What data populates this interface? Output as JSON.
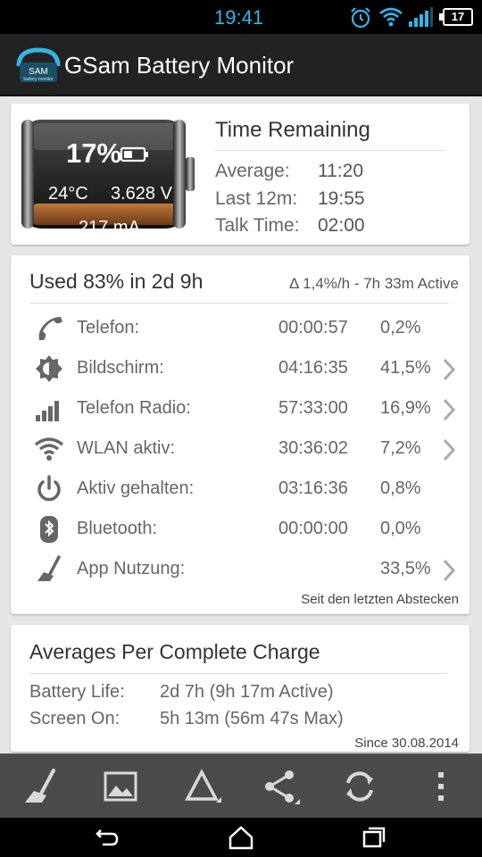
{
  "status_bar": {
    "time": "19:41",
    "battery_level": "17"
  },
  "app_bar": {
    "logo_text": "SAM",
    "logo_sub": "battery monitor",
    "title": "GSam Battery Monitor"
  },
  "battery": {
    "percent": "17%",
    "temperature": "24°C",
    "voltage": "3.628 V",
    "current": "217 mA"
  },
  "time_remaining": {
    "title": "Time Remaining",
    "rows": [
      {
        "label": "Average:",
        "value": "11:20"
      },
      {
        "label": "Last 12m:",
        "value": "19:55"
      },
      {
        "label": "Talk Time:",
        "value": "02:00"
      }
    ]
  },
  "usage": {
    "title": "Used 83% in 2d 9h",
    "rate": "Δ 1,4%/h - 7h 33m Active",
    "rows": [
      {
        "icon": "phone-icon",
        "label": "Telefon:",
        "time": "00:00:57",
        "percent": "0,2%",
        "has_arrow": false
      },
      {
        "icon": "screen-brightness-icon",
        "label": "Bildschirm:",
        "time": "04:16:35",
        "percent": "41,5%",
        "has_arrow": true
      },
      {
        "icon": "signal-bars-icon",
        "label": "Telefon Radio:",
        "time": "57:33:00",
        "percent": "16,9%",
        "has_arrow": true
      },
      {
        "icon": "wifi-icon",
        "label": "WLAN aktiv:",
        "time": "30:36:02",
        "percent": "7,2%",
        "has_arrow": true
      },
      {
        "icon": "power-icon",
        "label": "Aktiv gehalten:",
        "time": "03:16:36",
        "percent": "0,8%",
        "has_arrow": false
      },
      {
        "icon": "bluetooth-icon",
        "label": "Bluetooth:",
        "time": "00:00:00",
        "percent": "0,0%",
        "has_arrow": false
      },
      {
        "icon": "broom-icon",
        "label": "App Nutzung:",
        "time": "",
        "percent": "33,5%",
        "has_arrow": true
      }
    ],
    "since": "Seit den letzten Abstecken"
  },
  "averages": {
    "title": "Averages Per Complete Charge",
    "rows": [
      {
        "label": "Battery Life:",
        "value": "2d 7h (9h 17m Active)"
      },
      {
        "label": "Screen On:",
        "value": "5h 13m (56m 47s Max)"
      }
    ],
    "since": "Since 30.08.2014"
  },
  "toolbar": {
    "icons": [
      "broom-icon",
      "image-icon",
      "delta-icon",
      "share-icon",
      "refresh-icon",
      "overflow-menu-icon"
    ]
  },
  "nav": {
    "icons": [
      "back-icon",
      "home-icon",
      "recents-icon"
    ]
  },
  "colors": {
    "accent": "#33b5e5",
    "card": "#ffffff",
    "background": "#e6e6e6",
    "toolbar": "#4b4b4b"
  }
}
